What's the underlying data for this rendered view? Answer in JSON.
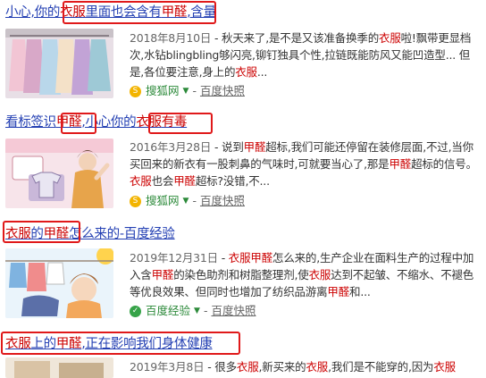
{
  "results": [
    {
      "title": [
        {
          "t": "小心,你的",
          "hl": false
        },
        {
          "t": "衣服",
          "hl": true
        },
        {
          "t": "里面也会含有",
          "hl": false
        },
        {
          "t": "甲醛",
          "hl": true
        },
        {
          "t": ",含量",
          "hl": false
        }
      ],
      "date": "2018年8月10日",
      "snippet": [
        {
          "t": " - 秋天来了,是不是又该准备换季的",
          "hl": false
        },
        {
          "t": "衣服",
          "hl": true
        },
        {
          "t": "啦!飘带更显档次,水钻blingbling够闪亮,铆钉独具个性,拉链既能防风又能凹造型... 但是,各位要注意,身上的",
          "hl": false
        },
        {
          "t": "衣服",
          "hl": true
        },
        {
          "t": "...",
          "hl": false
        }
      ],
      "source": "搜狐网",
      "source_icon": "sohu-icon",
      "source_color": "#f3b400",
      "kuaizhao": "百度快照"
    },
    {
      "title": [
        {
          "t": "看标签识",
          "hl": false
        },
        {
          "t": "甲醛",
          "hl": true
        },
        {
          "t": ",小心你的",
          "hl": false
        },
        {
          "t": "衣服",
          "hl": true
        },
        {
          "t": "有毒",
          "hl": true
        }
      ],
      "date": "2016年3月28日",
      "snippet": [
        {
          "t": " - 说到",
          "hl": false
        },
        {
          "t": "甲醛",
          "hl": true
        },
        {
          "t": "超标,我们可能还停留在装修层面,不过,当你买回来的新衣有一股刺鼻的气味时,可就要当心了,那是",
          "hl": false
        },
        {
          "t": "甲醛",
          "hl": true
        },
        {
          "t": "超标的信号。",
          "hl": false
        },
        {
          "t": "衣服",
          "hl": true
        },
        {
          "t": "也会",
          "hl": false
        },
        {
          "t": "甲醛",
          "hl": true
        },
        {
          "t": "超标?没错,不...",
          "hl": false
        }
      ],
      "source": "搜狐网",
      "source_icon": "sohu-icon",
      "source_color": "#f3b400",
      "kuaizhao": "百度快照"
    },
    {
      "title": [
        {
          "t": "衣服",
          "hl": true
        },
        {
          "t": "的",
          "hl": false
        },
        {
          "t": "甲醛",
          "hl": true
        },
        {
          "t": "怎么来的-百度经验",
          "hl": false
        }
      ],
      "date": "2019年12月31日",
      "snippet": [
        {
          "t": " - ",
          "hl": false
        },
        {
          "t": "衣服",
          "hl": true
        },
        {
          "t": "甲醛",
          "hl": true
        },
        {
          "t": "怎么来的,生产企业在面料生产的过程中加入含",
          "hl": false
        },
        {
          "t": "甲醛",
          "hl": true
        },
        {
          "t": "的染色助剂和树脂整理剂,使",
          "hl": false
        },
        {
          "t": "衣服",
          "hl": true
        },
        {
          "t": "达到不起皱、不缩水、不褪色等优良效果、但同时也增加了纺织品游离",
          "hl": false
        },
        {
          "t": "甲醛",
          "hl": true
        },
        {
          "t": "和...",
          "hl": false
        }
      ],
      "source": "百度经验",
      "source_icon": "baidu-jingyan-icon",
      "source_color": "#36a348",
      "kuaizhao": "百度快照"
    },
    {
      "title": [
        {
          "t": "衣服",
          "hl": true
        },
        {
          "t": "上的",
          "hl": false
        },
        {
          "t": "甲醛",
          "hl": true
        },
        {
          "t": ",正在影响我们身体健康",
          "hl": false
        }
      ],
      "date": "2019年3月8日",
      "snippet": [
        {
          "t": " - 很多",
          "hl": false
        },
        {
          "t": "衣服",
          "hl": true
        },
        {
          "t": ",新买来的",
          "hl": false
        },
        {
          "t": "衣服",
          "hl": true
        },
        {
          "t": ",我们是不能穿的,因为",
          "hl": false
        },
        {
          "t": "衣服",
          "hl": true
        }
      ]
    }
  ],
  "colors": {
    "link": "#2440b3",
    "highlight": "#c00000",
    "box": "#e0191a",
    "source_green": "#2c8a3a"
  }
}
